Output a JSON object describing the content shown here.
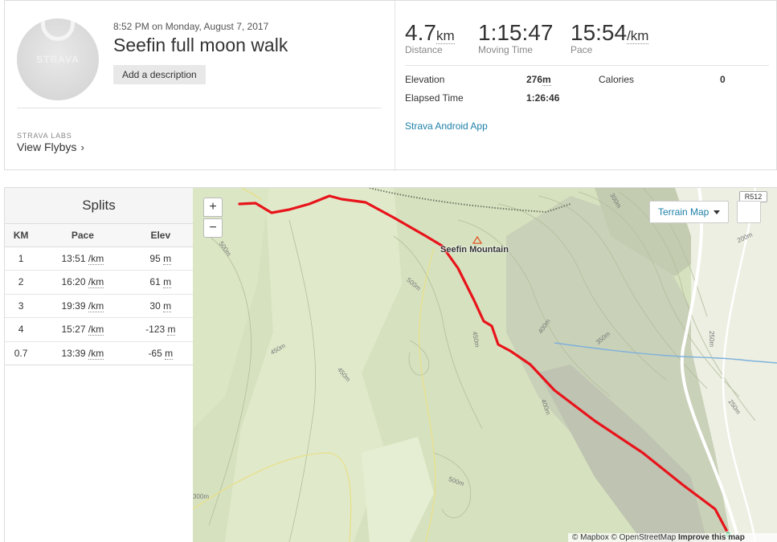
{
  "activity": {
    "datetime": "8:52 PM on Monday, August 7, 2017",
    "title": "Seefin full moon walk",
    "add_description_label": "Add a description",
    "avatar_brand": "STRAVA"
  },
  "labs": {
    "tag": "STRAVA LABS",
    "link_label": "View Flybys"
  },
  "stats": {
    "distance": {
      "value": "4.7",
      "unit": "km",
      "label": "Distance"
    },
    "moving_time": {
      "value": "1:15:47",
      "label": "Moving Time"
    },
    "pace": {
      "value": "15:54",
      "unit": "/km",
      "label": "Pace"
    },
    "elevation": {
      "label": "Elevation",
      "value": "276",
      "unit": "m"
    },
    "calories": {
      "label": "Calories",
      "value": "0"
    },
    "elapsed_time": {
      "label": "Elapsed Time",
      "value": "1:26:46"
    },
    "device": "Strava Android App"
  },
  "splits": {
    "title": "Splits",
    "columns": [
      "KM",
      "Pace",
      "Elev"
    ],
    "pace_unit": "/km",
    "elev_unit": "m",
    "rows": [
      {
        "km": "1",
        "pace": "13:51",
        "elev": "95"
      },
      {
        "km": "2",
        "pace": "16:20",
        "elev": "61"
      },
      {
        "km": "3",
        "pace": "19:39",
        "elev": "30"
      },
      {
        "km": "4",
        "pace": "15:27",
        "elev": "-123"
      },
      {
        "km": "0.7",
        "pace": "13:39",
        "elev": "-65"
      }
    ]
  },
  "map": {
    "zoom_in": "+",
    "zoom_out": "−",
    "layer_label": "Terrain Map",
    "road_badge": "R512",
    "peak_label": "Seefin Mountain",
    "contour_labels": [
      "500m",
      "500m",
      "450m",
      "450m",
      "500m",
      "400m",
      "400m",
      "450m",
      "300m",
      "200m",
      "250m",
      "250m",
      "350m",
      "300m"
    ],
    "attribution_prefix": "© Mapbox © OpenStreetMap",
    "attribution_link": "Improve this map",
    "colors": {
      "route": "#e8141b",
      "terrain": "#d7e3c0",
      "river": "#6aa6d8"
    }
  }
}
